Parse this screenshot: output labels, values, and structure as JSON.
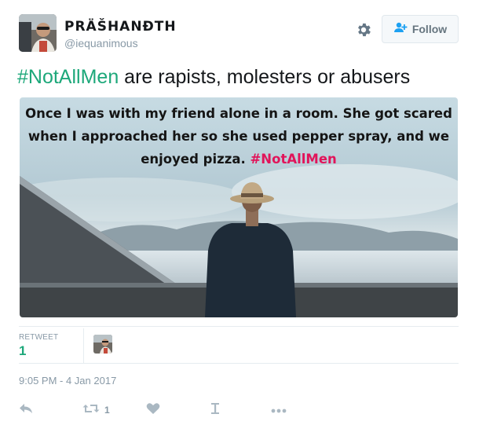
{
  "user": {
    "display_name": "PRÄŠHANÐTH",
    "handle": "@iequanimous"
  },
  "follow_button": {
    "label": "Follow"
  },
  "tweet": {
    "hashtag": "#NotAllMen",
    "text_rest": " are rapists, molesters or abusers"
  },
  "media": {
    "lines": [
      "Once I was with my friend alone in a room. She got scared",
      "when I approached her so she used pepper spray, and we",
      "enjoyed pizza."
    ],
    "tag": "#NotAllMen"
  },
  "stats": {
    "retweet_label": "RETWEET",
    "retweet_count": "1"
  },
  "timestamp": "9:05 PM - 4 Jan 2017",
  "actions": {
    "retweet_count": "1"
  },
  "icons": [
    "gear-icon",
    "add-user-icon",
    "reply-icon",
    "retweet-icon",
    "like-icon",
    "poll-icon",
    "more-icon"
  ],
  "colors": {
    "hashtag": "#1da87a",
    "overlay_tag": "#e1145a",
    "muted": "#8899a6",
    "icon": "#aab8c2"
  }
}
